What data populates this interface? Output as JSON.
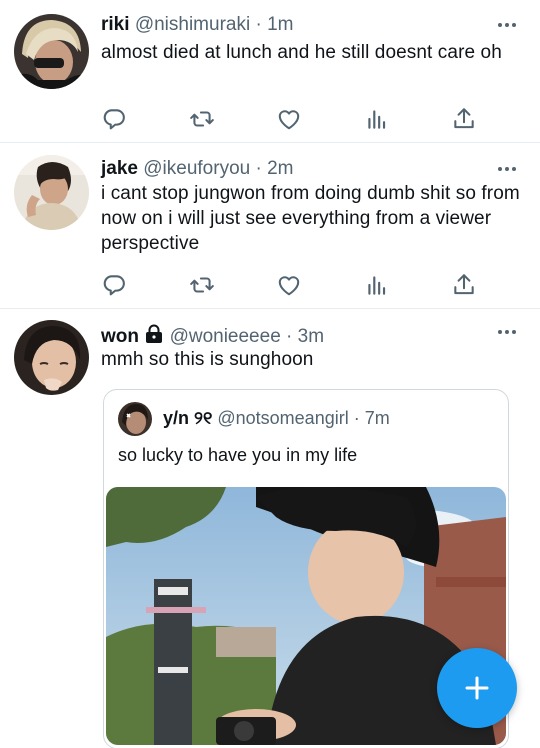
{
  "tweets": [
    {
      "name": "riki",
      "handle": "@nishimuraki",
      "dot": "·",
      "time": "1m",
      "text": "almost died at lunch and he still doesnt care oh"
    },
    {
      "name": "jake",
      "handle": "@ikeuforyou",
      "dot": "·",
      "time": "2m",
      "text": "i cant stop jungwon from doing dumb shit so from now on i will just see everything from a viewer perspective"
    },
    {
      "name": "won",
      "handle": "@wonieeeee",
      "dot": "·",
      "time": "3m",
      "text": "mmh so this is sunghoon",
      "locked": true,
      "quote": {
        "name": "y/n ୨୧",
        "handle": "@notsomeangirl",
        "dot": "·",
        "time": "7m",
        "text": "so lucky to have you in my life"
      }
    }
  ],
  "icons": {
    "reply": "reply-icon",
    "retweet": "retweet-icon",
    "like": "like-icon",
    "views": "views-icon",
    "share": "share-icon",
    "more": "more-icon",
    "lock": "lock-icon",
    "compose": "compose-icon"
  },
  "colors": {
    "accent": "#1d9bf0",
    "text_secondary": "#536471",
    "divider": "#e6ecf0"
  }
}
